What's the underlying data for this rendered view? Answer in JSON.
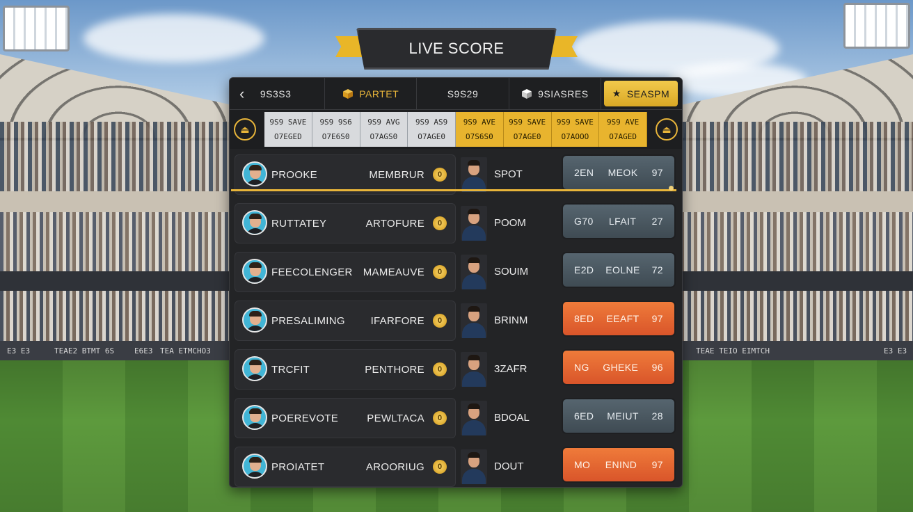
{
  "banner": {
    "title": "LIVE SCORE"
  },
  "board_texts": [
    "E3 E3",
    "TEAE2 BTMT 6S",
    "E6E3",
    "TEA ETMCHO3",
    "TEAE TEIO EIMTCH",
    "E3 E3"
  ],
  "tabs": [
    {
      "label": "9S3S3",
      "icon": "back-chevron-icon"
    },
    {
      "label": "PARTET",
      "icon": "cube-icon"
    },
    {
      "label": "S9S29",
      "icon": ""
    },
    {
      "label": "9SIASRES",
      "icon": "cube-icon"
    },
    {
      "label": "SEASPM",
      "icon": "star-icon",
      "active": true
    }
  ],
  "columns": [
    {
      "top": "9S9 SAVE",
      "bottom": "O7EGED",
      "style": "grey"
    },
    {
      "top": "9S9 9S6",
      "bottom": "O7E6S0",
      "style": "grey"
    },
    {
      "top": "9S9 AVG",
      "bottom": "O7AGS0",
      "style": "grey"
    },
    {
      "top": "9S9 AS9",
      "bottom": "O7AGE0",
      "style": "grey"
    },
    {
      "top": "9S9 AVE",
      "bottom": "O7S6S0",
      "style": "gold"
    },
    {
      "top": "9S9 SAVE",
      "bottom": "O7AGE0",
      "style": "gold"
    },
    {
      "top": "9S9 SAVE",
      "bottom": "O7AOOO",
      "style": "gold"
    },
    {
      "top": "9S9 AVE",
      "bottom": "O7AGED",
      "style": "gold"
    }
  ],
  "rows": [
    {
      "name": "PROOKE",
      "team": "MEMBRUR",
      "coin": "0",
      "opponent": "SPOT",
      "score": {
        "a": "2EN",
        "b": "MEOK",
        "c": "97",
        "style": "slate"
      },
      "highlight": true
    },
    {
      "name": "RUTTATEY",
      "team": "ARTOFURE",
      "coin": "0",
      "opponent": "POOM",
      "score": {
        "a": "G70",
        "b": "LFAIT",
        "c": "27",
        "style": "slate"
      }
    },
    {
      "name": "FEECOLENGER",
      "team": "MAMEAUVE",
      "coin": "0",
      "opponent": "SOUIM",
      "score": {
        "a": "E2D",
        "b": "EOLNE",
        "c": "72",
        "style": "slate"
      }
    },
    {
      "name": "PRESALIMING",
      "team": "IFARFORE",
      "coin": "0",
      "opponent": "BRINM",
      "score": {
        "a": "8ED",
        "b": "EEAFT",
        "c": "97",
        "style": "orange"
      }
    },
    {
      "name": "TRCFIT",
      "team": "PENTHORE",
      "coin": "0",
      "opponent": "3ZAFR",
      "score": {
        "a": "NG",
        "b": "GHEKE",
        "c": "96",
        "style": "orange"
      }
    },
    {
      "name": "POEREVOTE",
      "team": "PEWLTACA",
      "coin": "0",
      "opponent": "BDOAL",
      "score": {
        "a": "6ED",
        "b": "MEIUT",
        "c": "28",
        "style": "slate"
      }
    },
    {
      "name": "PROIATET",
      "team": "AROORIUG",
      "coin": "0",
      "opponent": "DOUT",
      "score": {
        "a": "MO",
        "b": "ENIND",
        "c": "97",
        "style": "orange"
      }
    }
  ],
  "colors": {
    "accent": "#e8b53a",
    "panel": "#232426",
    "orange": "#e36532",
    "slate": "#4b5862"
  }
}
